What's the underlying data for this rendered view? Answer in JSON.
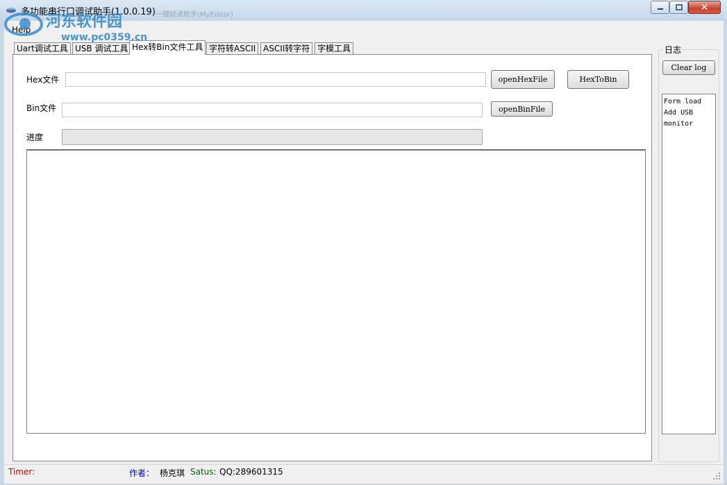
{
  "window": {
    "title": "多功能串行口调试助手(1.0.0.19)",
    "watermark_title": "一键轻读助手(MyEditor)",
    "watermark_brand": "河东软件园",
    "watermark_url": "www.pc0359.cn",
    "close_glyph": "✕"
  },
  "menu": {
    "help": "Help"
  },
  "tabs": [
    {
      "label": "Uart调试工具",
      "active": false
    },
    {
      "label": "USB 调试工具",
      "active": false
    },
    {
      "label": "Hex转Bin文件工具",
      "active": true
    },
    {
      "label": "字符转ASCII",
      "active": false
    },
    {
      "label": "ASCII转字符",
      "active": false
    },
    {
      "label": "字模工具",
      "active": false
    }
  ],
  "hex_panel": {
    "hex_label": "Hex文件",
    "hex_value": "",
    "open_hex_button": "openHexFile",
    "hex_to_bin_button": "HexToBin",
    "bin_label": "Bin文件",
    "bin_value": "",
    "open_bin_button": "openBinFile",
    "progress_label": "进度",
    "progress": 0,
    "output": ""
  },
  "log": {
    "title": "日志",
    "clear_button": "Clear log",
    "entries": [
      "Form load",
      "Add USB",
      "monitor"
    ]
  },
  "statusbar": {
    "timer_label": "Timer:",
    "author_label": "作者：",
    "author_name": "杨克琪",
    "status_label": "Satus:",
    "status_value": "QQ:289601315"
  },
  "colors": {
    "timer": "#cc0000",
    "author_label": "#0000cc",
    "status_label": "#006600",
    "accent": "#2f86c9"
  }
}
